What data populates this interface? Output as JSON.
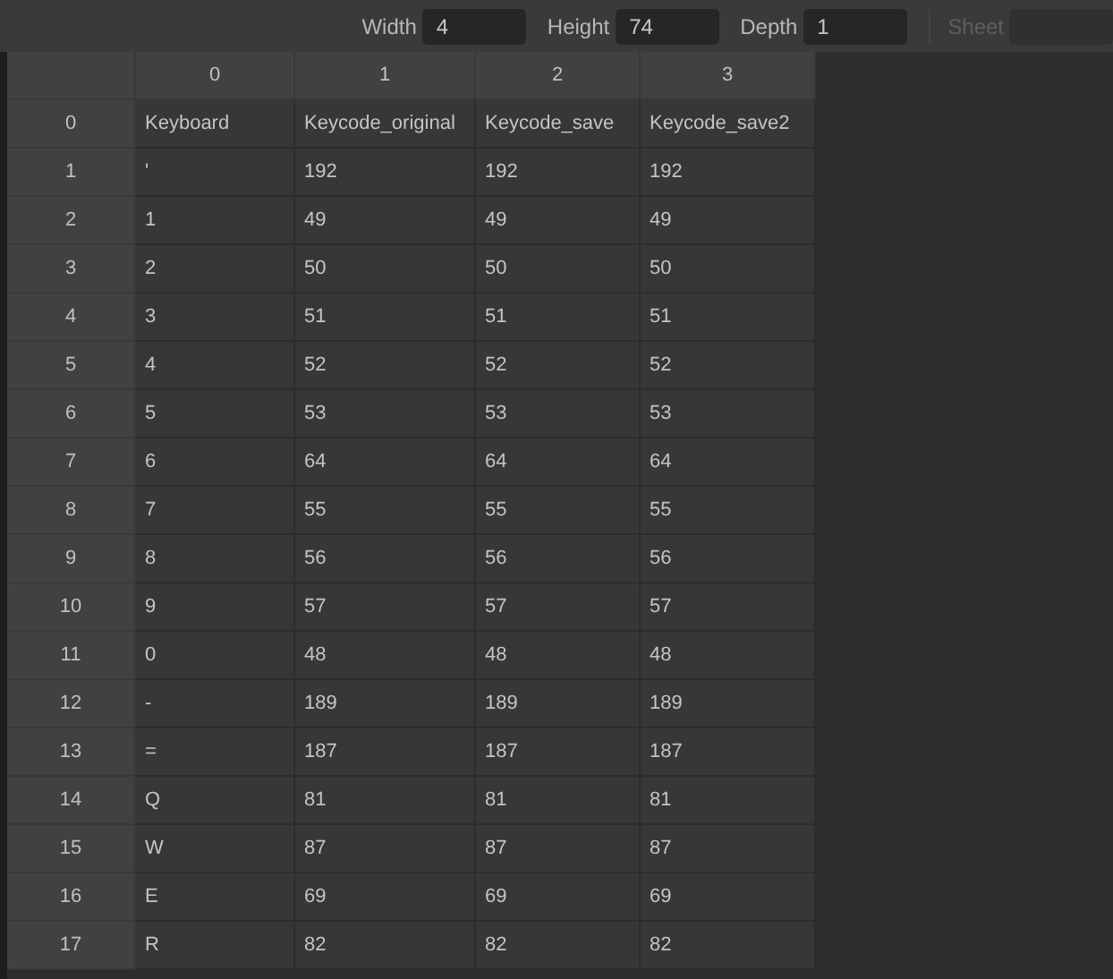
{
  "toolbar": {
    "fields": [
      {
        "label": "Width",
        "value": "4",
        "disabled": false
      },
      {
        "label": "Height",
        "value": "74",
        "disabled": false
      },
      {
        "label": "Depth",
        "value": "1",
        "disabled": false
      },
      {
        "label": "Sheet",
        "disabled": true
      }
    ]
  },
  "table": {
    "columns": [
      "0",
      "1",
      "2",
      "3"
    ],
    "rows": [
      {
        "index": "0",
        "cells": [
          "Keyboard",
          "Keycode_original",
          "Keycode_save",
          "Keycode_save2"
        ]
      },
      {
        "index": "1",
        "cells": [
          "'",
          "192",
          "192",
          "192"
        ]
      },
      {
        "index": "2",
        "cells": [
          "1",
          "49",
          "49",
          "49"
        ]
      },
      {
        "index": "3",
        "cells": [
          "2",
          "50",
          "50",
          "50"
        ]
      },
      {
        "index": "4",
        "cells": [
          "3",
          "51",
          "51",
          "51"
        ]
      },
      {
        "index": "5",
        "cells": [
          "4",
          "52",
          "52",
          "52"
        ]
      },
      {
        "index": "6",
        "cells": [
          "5",
          "53",
          "53",
          "53"
        ]
      },
      {
        "index": "7",
        "cells": [
          "6",
          "64",
          "64",
          "64"
        ]
      },
      {
        "index": "8",
        "cells": [
          "7",
          "55",
          "55",
          "55"
        ]
      },
      {
        "index": "9",
        "cells": [
          "8",
          "56",
          "56",
          "56"
        ]
      },
      {
        "index": "10",
        "cells": [
          "9",
          "57",
          "57",
          "57"
        ]
      },
      {
        "index": "11",
        "cells": [
          "0",
          "48",
          "48",
          "48"
        ]
      },
      {
        "index": "12",
        "cells": [
          "-",
          "189",
          "189",
          "189"
        ]
      },
      {
        "index": "13",
        "cells": [
          "=",
          "187",
          "187",
          "187"
        ]
      },
      {
        "index": "14",
        "cells": [
          "Q",
          "81",
          "81",
          "81"
        ]
      },
      {
        "index": "15",
        "cells": [
          "W",
          "87",
          "87",
          "87"
        ]
      },
      {
        "index": "16",
        "cells": [
          "E",
          "69",
          "69",
          "69"
        ]
      },
      {
        "index": "17",
        "cells": [
          "R",
          "82",
          "82",
          "82"
        ]
      }
    ]
  }
}
